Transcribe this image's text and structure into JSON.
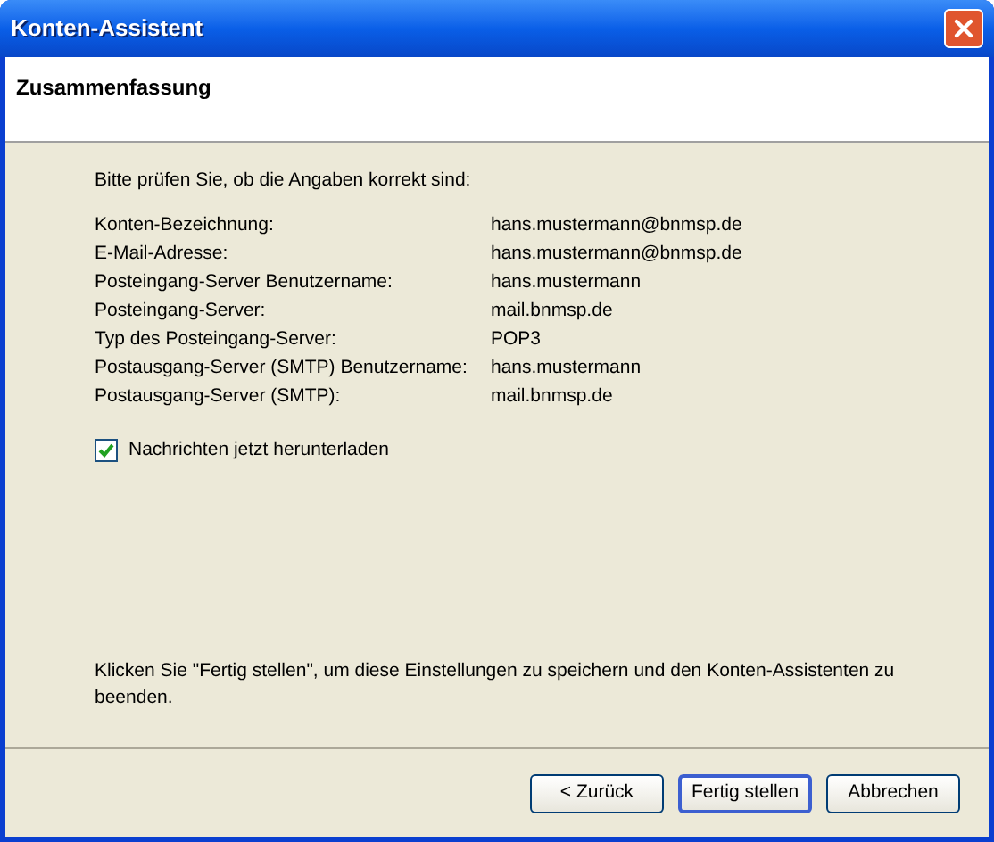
{
  "window": {
    "title": "Konten-Assistent"
  },
  "header": {
    "title": "Zusammenfassung"
  },
  "intro": "Bitte prüfen Sie, ob die Angaben korrekt sind:",
  "summary": [
    {
      "label": "Konten-Bezeichnung:",
      "value": "hans.mustermann@bnmsp.de"
    },
    {
      "label": "E-Mail-Adresse:",
      "value": "hans.mustermann@bnmsp.de"
    },
    {
      "label": "Posteingang-Server Benutzername:",
      "value": "hans.mustermann"
    },
    {
      "label": "Posteingang-Server:",
      "value": "mail.bnmsp.de"
    },
    {
      "label": "Typ des Posteingang-Server:",
      "value": "POP3"
    },
    {
      "label": "Postausgang-Server (SMTP) Benutzername:",
      "value": "hans.mustermann"
    },
    {
      "label": "Postausgang-Server (SMTP):",
      "value": "mail.bnmsp.de"
    }
  ],
  "download_checkbox": {
    "label": "Nachrichten jetzt herunterladen",
    "checked": true
  },
  "hint": "Klicken Sie \"Fertig stellen\", um diese Einstellungen zu speichern und den Konten-Assistenten zu beenden.",
  "buttons": [
    {
      "label": "< Zurück",
      "default": false
    },
    {
      "label": "Fertig stellen",
      "default": true
    },
    {
      "label": "Abbrechen",
      "default": false
    }
  ]
}
